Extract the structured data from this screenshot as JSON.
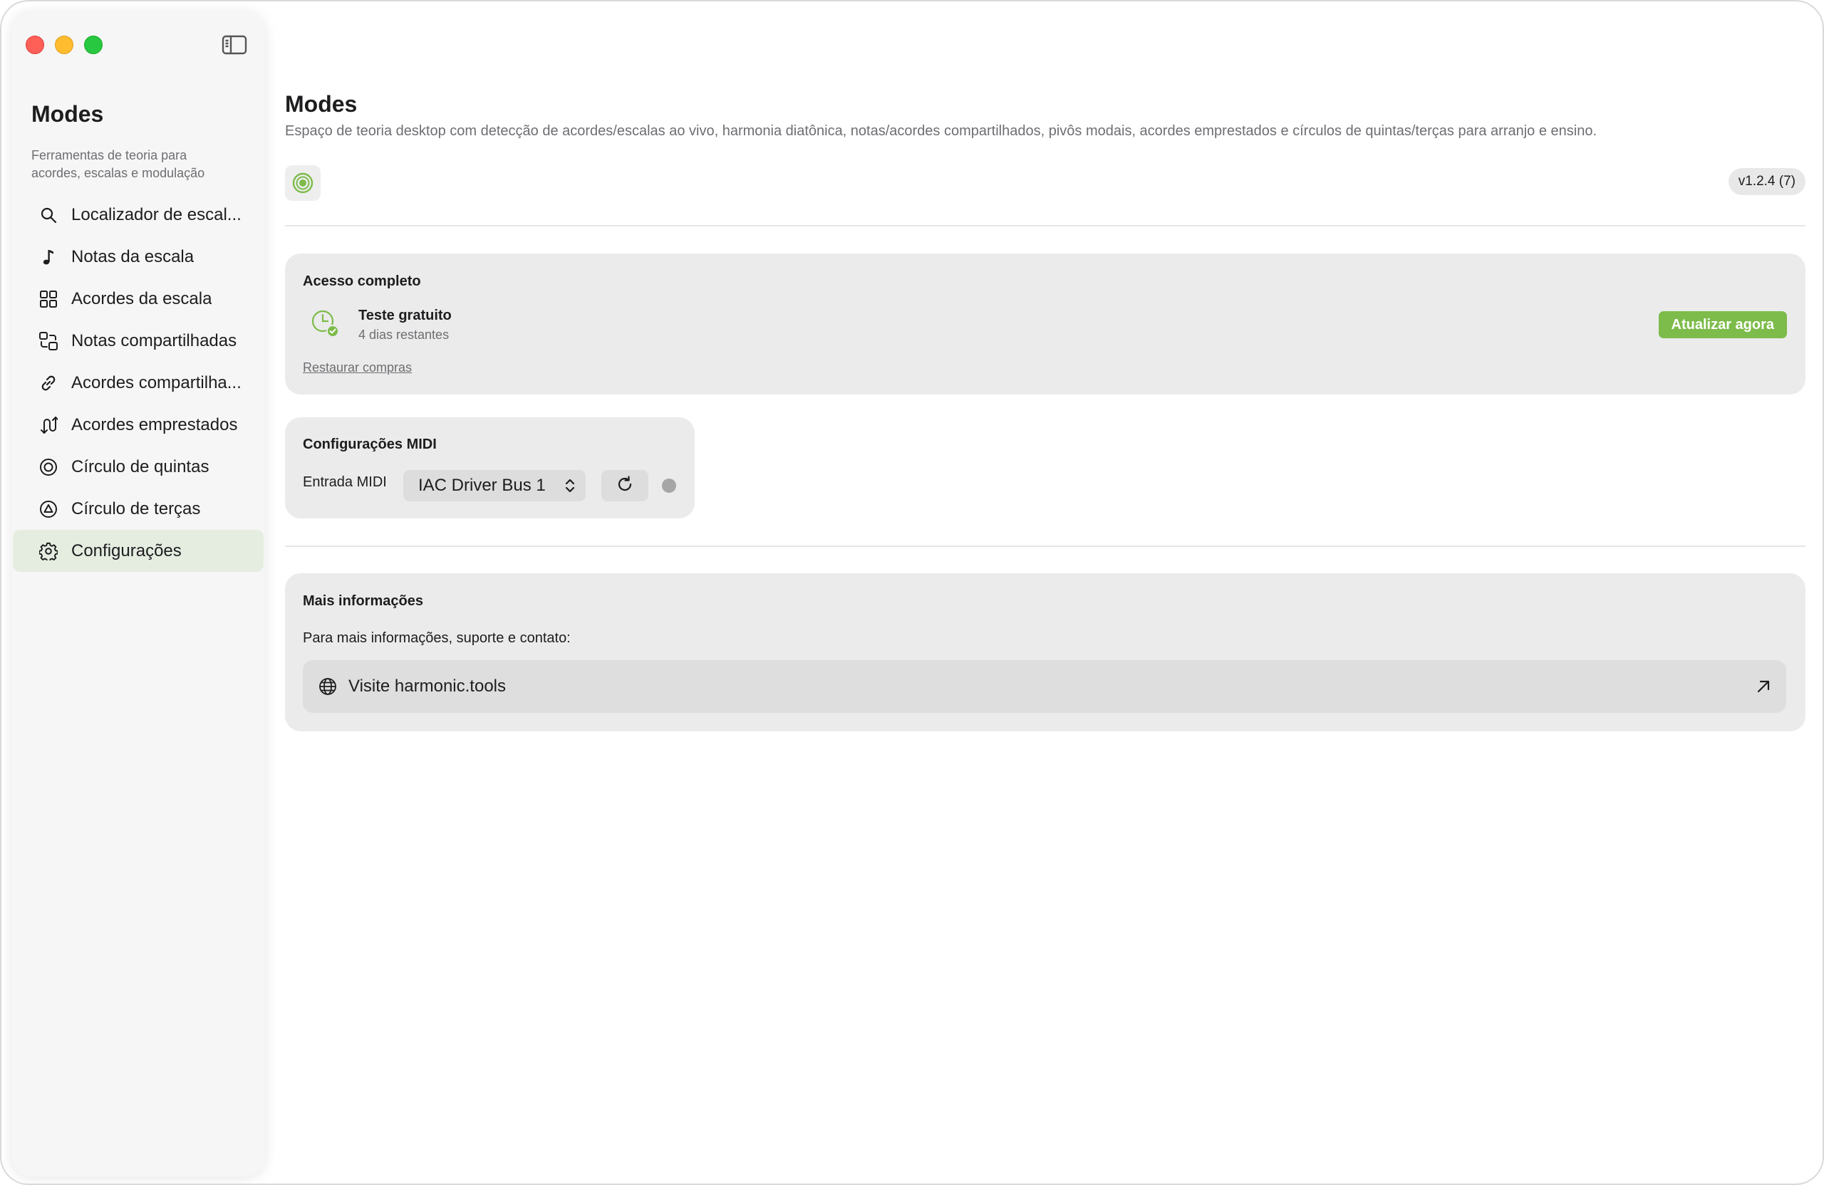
{
  "sidebar": {
    "title": "Modes",
    "subtitle": "Ferramentas de teoria para acordes, escalas e modulação",
    "items": [
      {
        "label": "Localizador de escal...",
        "icon": "magnifier-icon"
      },
      {
        "label": "Notas da escala",
        "icon": "music-note-icon"
      },
      {
        "label": "Acordes da escala",
        "icon": "grid-icon"
      },
      {
        "label": "Notas compartilhadas",
        "icon": "shared-squares-icon"
      },
      {
        "label": "Acordes compartilha...",
        "icon": "link-icon"
      },
      {
        "label": "Acordes emprestados",
        "icon": "borrow-arrows-icon"
      },
      {
        "label": "Círculo de quintas",
        "icon": "circle-icon"
      },
      {
        "label": "Círculo de terças",
        "icon": "triangle-circle-icon"
      },
      {
        "label": "Configurações",
        "icon": "gear-icon",
        "active": true
      }
    ]
  },
  "header": {
    "title": "Modes",
    "description": "Espaço de teoria desktop com detecção de acordes/escalas ao vivo, harmonia diatônica, notas/acordes compartilhados, pivôs modais, acordes emprestados e círculos de quintas/terças para arranjo e ensino.",
    "version": "v1.2.4 (7)"
  },
  "access": {
    "title": "Acesso completo",
    "trial_name": "Teste gratuito",
    "trial_days": "4 dias restantes",
    "restore_label": "Restaurar compras",
    "upgrade_label": "Atualizar agora"
  },
  "midi": {
    "title": "Configurações MIDI",
    "input_label": "Entrada MIDI",
    "selected_input": "IAC Driver Bus 1"
  },
  "info": {
    "title": "Mais informações",
    "text": "Para mais informações, suporte e contato:",
    "visit_label": "Visite harmonic.tools"
  },
  "colors": {
    "accent": "#7dbb4a",
    "active_nav_bg": "#e5ede1",
    "status_dot": "#a6a6a6"
  }
}
